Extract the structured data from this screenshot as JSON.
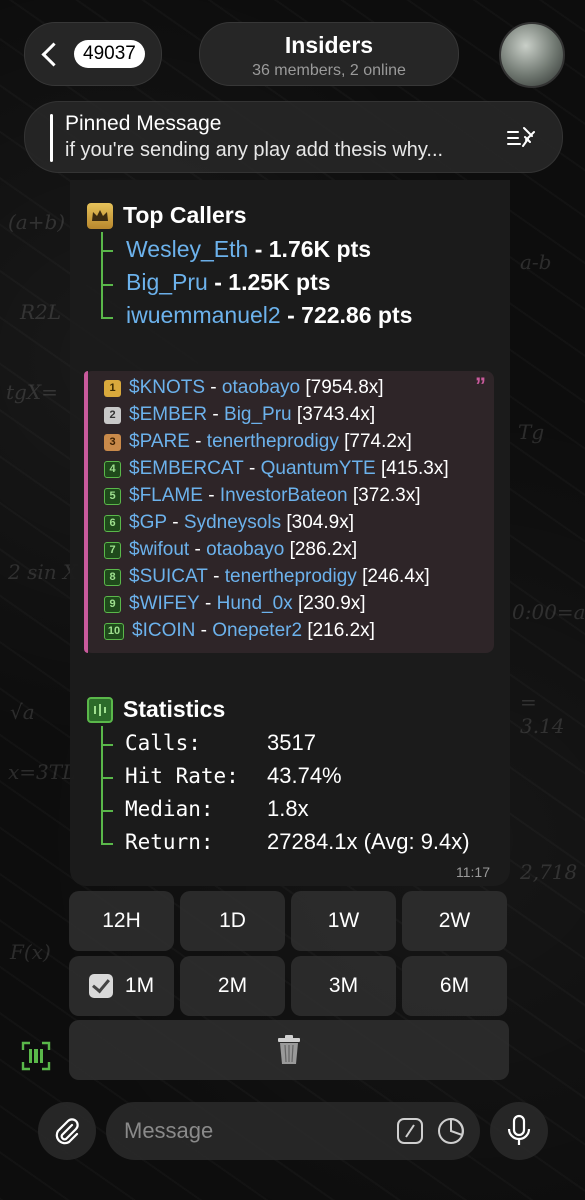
{
  "header": {
    "back_count": "49037",
    "title": "Insiders",
    "subtitle": "36 members, 2 online"
  },
  "pinned": {
    "title": "Pinned Message",
    "text": "if you're sending any play add thesis why..."
  },
  "message": {
    "top_callers_title": "Top Callers",
    "top_callers": [
      {
        "name": "Wesley_Eth",
        "pts": "1.76K pts"
      },
      {
        "name": "Big_Pru",
        "pts": "1.25K pts"
      },
      {
        "name": "iwuemmanuel2",
        "pts": "722.86 pts"
      }
    ],
    "ranks": [
      {
        "n": "1",
        "token": "$KNOTS",
        "user": "otaobayo",
        "mult": "[7954.8x]"
      },
      {
        "n": "2",
        "token": "$EMBER",
        "user": "Big_Pru",
        "mult": "[3743.4x]"
      },
      {
        "n": "3",
        "token": "$PARE",
        "user": "tenertheprodigy",
        "mult": "[774.2x]"
      },
      {
        "n": "4",
        "token": "$EMBERCAT",
        "user": "QuantumYTE",
        "mult": "[415.3x]"
      },
      {
        "n": "5",
        "token": "$FLAME",
        "user": "InvestorBateon",
        "mult": "[372.3x]"
      },
      {
        "n": "6",
        "token": "$GP",
        "user": "Sydneysols",
        "mult": "[304.9x]"
      },
      {
        "n": "7",
        "token": "$wifout",
        "user": "otaobayo",
        "mult": "[286.2x]"
      },
      {
        "n": "8",
        "token": "$SUICAT",
        "user": "tenertheprodigy",
        "mult": "[246.4x]"
      },
      {
        "n": "9",
        "token": "$WIFEY",
        "user": "Hund_0x",
        "mult": "[230.9x]"
      },
      {
        "n": "10",
        "token": "$ICOIN",
        "user": "Onepeter2",
        "mult": "[216.2x]"
      }
    ],
    "statistics_title": "Statistics",
    "stats": [
      {
        "label": "Calls:",
        "value": "3517"
      },
      {
        "label": "Hit Rate:",
        "value": "43.74%"
      },
      {
        "label": "Median:",
        "value": "1.8x"
      },
      {
        "label": "Return:",
        "value": "27284.1x (Avg: 9.4x)"
      }
    ],
    "time": "11:17"
  },
  "keyboard": {
    "row1": [
      "12H",
      "1D",
      "1W",
      "2W"
    ],
    "row2": [
      "1M",
      "2M",
      "3M",
      "6M"
    ],
    "selected": "1M"
  },
  "composer": {
    "placeholder": "Message"
  },
  "colors": {
    "link": "#6cb2ec",
    "tree": "#5ab84a",
    "quote_accent": "#c95a9c"
  }
}
